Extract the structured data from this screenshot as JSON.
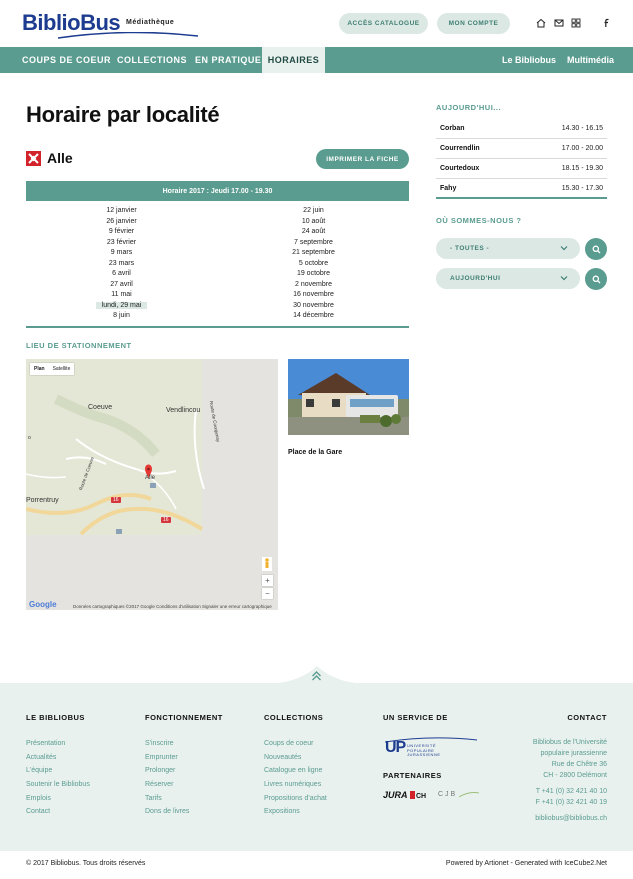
{
  "header": {
    "logo_main": "BiblioBus",
    "logo_sub": "Médiathèque",
    "btn_catalogue": "ACCÈS CATALOGUE",
    "btn_account": "MON COMPTE"
  },
  "nav": {
    "items": [
      "COUPS DE COEUR",
      "COLLECTIONS",
      "EN PRATIQUE",
      "HORAIRES"
    ],
    "right": [
      "Le Bibliobus",
      "Multimédia"
    ]
  },
  "main": {
    "title": "Horaire par localité",
    "locality": "Alle",
    "print_label": "IMPRIMER LA FICHE",
    "horaire_label": "Horaire 2017 : Jeudi 17.00 - 19.30",
    "dates_left": [
      "12 janvier",
      "26 janvier",
      "9 février",
      "23 février",
      "9 mars",
      "23 mars",
      "6 avril",
      "27 avril",
      "11 mai",
      "lundi, 29 mai",
      "8 juin"
    ],
    "dates_right": [
      "22 juin",
      "10 août",
      "24 août",
      "7 septembre",
      "21 septembre",
      "5 octobre",
      "19 octobre",
      "2 novembre",
      "16 novembre",
      "30 novembre",
      "14 décembre"
    ],
    "parking_heading": "LIEU DE STATIONNEMENT",
    "photo_caption": "Place de la Gare"
  },
  "map": {
    "tab_plan": "Plan",
    "tab_satellite": "Satellite",
    "labels": {
      "coeuve": "Coeuve",
      "vendlincourt": "Vendlincou",
      "porrentruy": "Porrentruy",
      "alle": "Alle",
      "route1": "Route de Coeuve",
      "route2": "Route de Courgenay",
      "n16a": "16",
      "n16b": "16"
    },
    "google": "Google",
    "zoom_in": "+",
    "zoom_out": "−",
    "footer": "Données cartographiques ©2017 Google    Conditions d'utilisation    Signaler une erreur cartographique"
  },
  "sidebar": {
    "today_heading": "AUJOURD'HUI...",
    "today": [
      {
        "place": "Corban",
        "time": "14.30 - 16.15"
      },
      {
        "place": "Courrendlin",
        "time": "17.00 - 20.00"
      },
      {
        "place": "Courtedoux",
        "time": "18.15 - 19.30"
      },
      {
        "place": "Fahy",
        "time": "15.30 - 17.30"
      }
    ],
    "where_heading": "OÙ SOMMES-NOUS ?",
    "select_place": "- TOUTES -",
    "select_day": "AUJOURD'HUI"
  },
  "footer": {
    "col1": {
      "title": "LE BIBLIOBUS",
      "links": [
        "Présentation",
        "Actualités",
        "L'équipe",
        "Soutenir le Bibliobus",
        "Emplois",
        "Contact"
      ]
    },
    "col2": {
      "title": "FONCTIONNEMENT",
      "links": [
        "S'inscrire",
        "Emprunter",
        "Prolonger",
        "Réserver",
        "Tarifs",
        "Dons de livres"
      ]
    },
    "col3": {
      "title": "COLLECTIONS",
      "links": [
        "Coups de coeur",
        "Nouveautés",
        "Catalogue en ligne",
        "Livres numériques",
        "Propositions d'achat",
        "Expositions"
      ]
    },
    "col4": {
      "title": "UN SERVICE DE",
      "partners_title": "PARTENAIRES",
      "up_logo": "UP",
      "up_text": "UNIVERSITÉ POPULAIRE JURASSIENNE",
      "jura_logo": "JURA",
      "cjb_logo": "CJB"
    },
    "contact": {
      "title": "CONTACT",
      "lines": [
        "Bibliobus de l'Université",
        "populaire jurassienne",
        "Rue de Chêtre 36",
        "CH - 2800 Delémont"
      ],
      "phone": "T +41 (0) 32 421 40 10",
      "fax": "F +41 (0) 32 421 40 19",
      "email": "bibliobus@bibliobus.ch"
    },
    "copyright": "© 2017 Bibliobus. Tous droits réservés",
    "powered": "Powered by Artionet - Generated with IceCube2.Net"
  },
  "colors": {
    "accent": "#5a9c8f",
    "accent_light": "#dbe8e4",
    "footer_bg": "#e9f1ef",
    "logo_blue": "#1d3c8f"
  }
}
